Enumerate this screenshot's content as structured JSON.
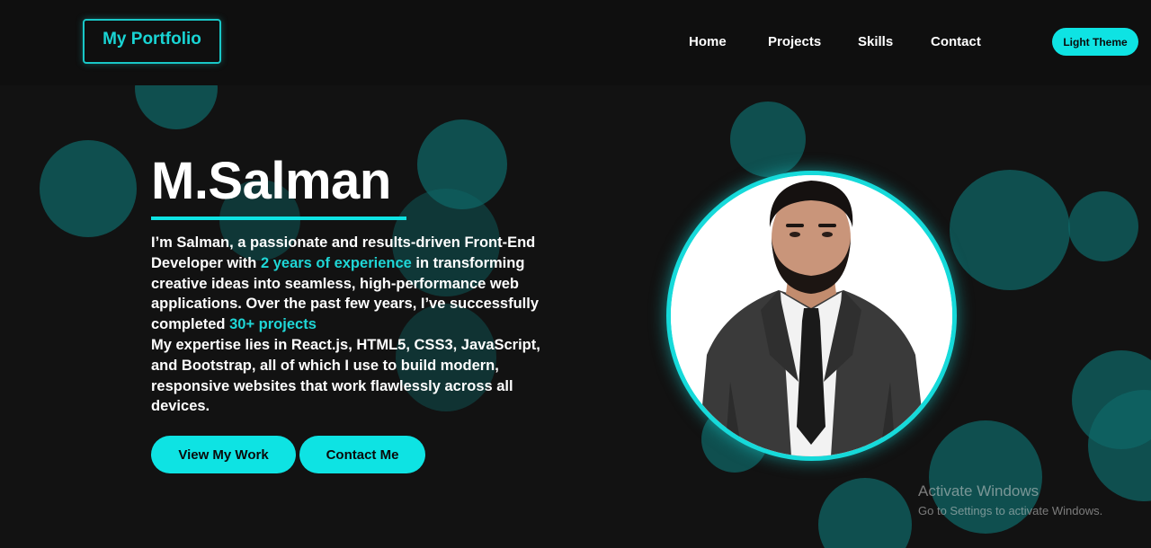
{
  "header": {
    "logo_text": "My Portfolio",
    "nav": [
      {
        "label": "Home"
      },
      {
        "label": "Projects"
      },
      {
        "label": "Skills"
      },
      {
        "label": "Contact"
      }
    ],
    "theme_button_label": "Light Theme"
  },
  "hero": {
    "name": "M.Salman",
    "bio": {
      "part1": "I’m Salman, a passionate and results-driven Front-End Developer with ",
      "highlight1": "2 years of experience",
      "part2": " in transforming creative ideas into seamless, high-performance web applications. Over the past few years, I’ve successfully completed ",
      "highlight2": "30+ projects",
      "part3": "My expertise lies in React.js, HTML5, CSS3, JavaScript, and Bootstrap, all of which I use to build modern, responsive websites that work flawlessly across all devices."
    },
    "buttons": {
      "view_work": "View My Work",
      "contact": "Contact Me"
    }
  },
  "portrait": {
    "icon": "profile-photo"
  },
  "watermark": {
    "title": "Activate Windows",
    "subtitle": "Go to Settings to activate Windows."
  },
  "colors": {
    "accent": "#0ee3e3",
    "background": "#121212",
    "bubble": "#0e6666"
  }
}
